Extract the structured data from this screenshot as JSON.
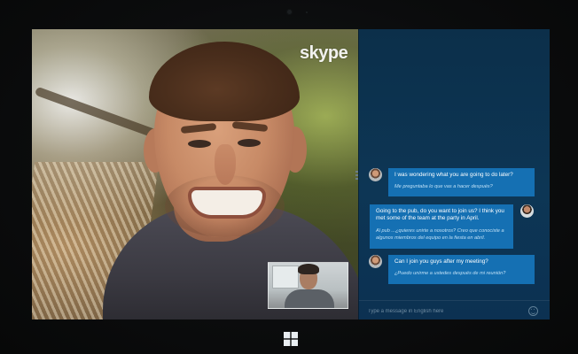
{
  "app": {
    "logo_text": "skype"
  },
  "chat": {
    "messages": [
      {
        "sender": "remote",
        "text": "I was wondering what you are going to do later?",
        "translation": "Me preguntaba lo que vas a hacer después?"
      },
      {
        "sender": "self",
        "text": "Going to the pub, do you want to join us? I think you met some of the team at the party in April.",
        "translation": "Al pub ...¿quieres unirte a nosotros? Creo que conociste a algunos miembros del equipo en la fiesta en abril."
      },
      {
        "sender": "remote",
        "text": "Can I join you guys after my meeting?",
        "translation": "¿Puedo unirme a ustedes después de mi reunión?"
      }
    ],
    "input_placeholder": "Type a message in English here"
  },
  "icons": {
    "logo": "skype-logo",
    "emoji": "emoji-icon",
    "windows": "windows-logo-icon"
  },
  "colors": {
    "chat_background": "#0d3655",
    "bubble": "#1570b3",
    "translation_text": "#bfe0f6"
  }
}
